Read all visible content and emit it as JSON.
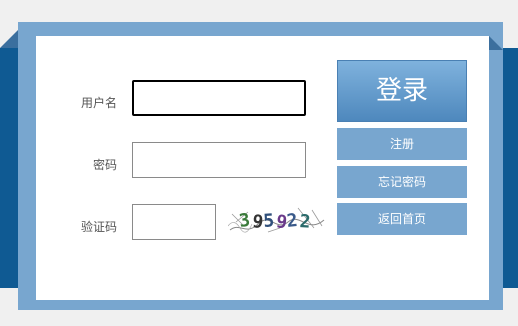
{
  "form": {
    "username_label": "用户名",
    "password_label": "密码",
    "captcha_label": "验证码",
    "username_value": "",
    "password_value": "",
    "captcha_value": "",
    "captcha_text": "395922"
  },
  "buttons": {
    "login": "登录",
    "register": "注册",
    "forgot_password": "忘记密码",
    "back_home": "返回首页"
  },
  "colors": {
    "band": "#0f5a93",
    "frame": "#78a6cf",
    "button": "#78a6cf"
  }
}
